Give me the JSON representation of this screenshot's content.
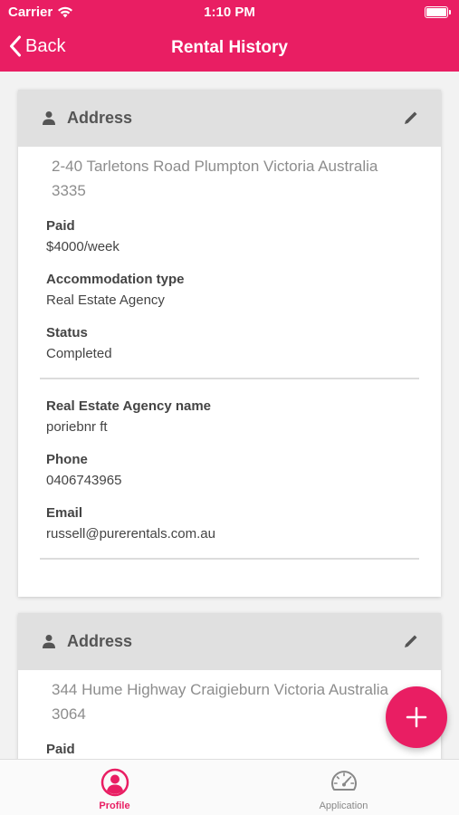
{
  "status_bar": {
    "carrier": "Carrier",
    "time": "1:10 PM"
  },
  "nav": {
    "back_label": "Back",
    "title": "Rental History"
  },
  "records": [
    {
      "header_label": "Address",
      "address": "2-40 Tarletons Road Plumpton Victoria Australia 3335",
      "paid_label": "Paid",
      "paid": "$4000/week",
      "accommodation_label": "Accommodation type",
      "accommodation": "Real Estate Agency",
      "status_label": "Status",
      "status": "Completed",
      "agency_label": "Real Estate Agency name",
      "agency": "poriebnr ft",
      "phone_label": "Phone",
      "phone": "0406743965",
      "email_label": "Email",
      "email": "russell@purerentals.com.au"
    },
    {
      "header_label": "Address",
      "address": "344 Hume Highway Craigieburn Victoria Australia 3064",
      "paid_label": "Paid"
    }
  ],
  "tabs": [
    {
      "label": "Profile",
      "icon": "profile-icon",
      "active": true
    },
    {
      "label": "Application",
      "icon": "speedometer-icon",
      "active": false
    }
  ],
  "colors": {
    "accent": "#e91e63",
    "header_gray": "#e0e0e0"
  }
}
